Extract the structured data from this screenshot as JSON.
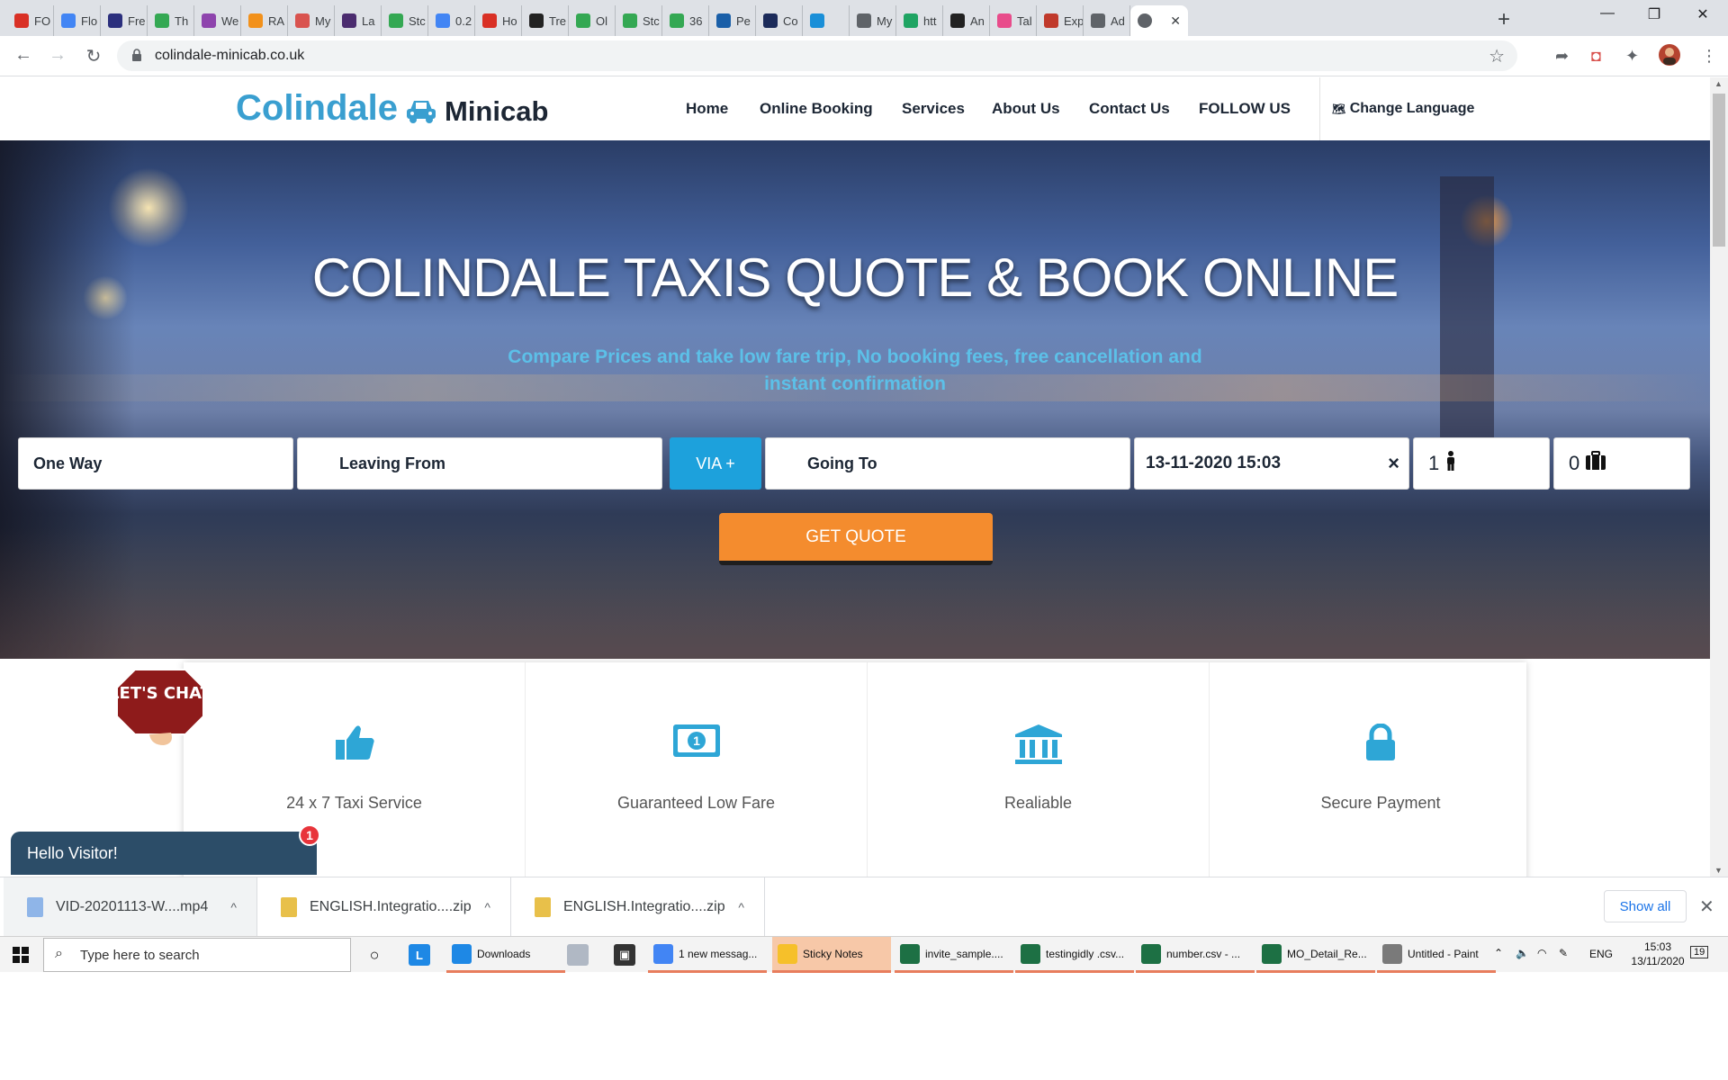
{
  "browser": {
    "tabs": [
      {
        "label": "FO",
        "icon": "gmail-icon",
        "color": "#d93025"
      },
      {
        "label": "Flo",
        "icon": "google-icon",
        "color": "#4285f4"
      },
      {
        "label": "Fre",
        "icon": "nb-icon",
        "color": "#2b2f7d"
      },
      {
        "label": "Th",
        "icon": "maps-icon",
        "color": "#34a853"
      },
      {
        "label": "We",
        "icon": "colorful-icon",
        "color": "#8e44ad"
      },
      {
        "label": "RA",
        "icon": "rss-icon",
        "color": "#f2911b"
      },
      {
        "label": "My",
        "icon": "arrow-icon",
        "color": "#d9534f"
      },
      {
        "label": "La",
        "icon": "taxi-icon",
        "color": "#4b2c6f"
      },
      {
        "label": "Stc",
        "icon": "maps-icon",
        "color": "#34a853"
      },
      {
        "label": "0.2",
        "icon": "google-icon",
        "color": "#4285f4"
      },
      {
        "label": "Ho",
        "icon": "n-icon",
        "color": "#d93025"
      },
      {
        "label": "Tre",
        "icon": "taxi-icon",
        "color": "#222"
      },
      {
        "label": "Ol",
        "icon": "maps-icon",
        "color": "#34a853"
      },
      {
        "label": "Stc",
        "icon": "maps-icon",
        "color": "#34a853"
      },
      {
        "label": "36",
        "icon": "maps-icon",
        "color": "#34a853"
      },
      {
        "label": "Pe",
        "icon": "c-icon",
        "color": "#1a5fa8"
      },
      {
        "label": "Co",
        "icon": "utv-icon",
        "color": "#1c2b5a"
      },
      {
        "label": "",
        "icon": "y-icon",
        "color": "#1a8fd8"
      },
      {
        "label": "My",
        "icon": "globe-icon",
        "color": "#5f6368"
      },
      {
        "label": "htt",
        "icon": "star-icon",
        "color": "#1fa463"
      },
      {
        "label": "An",
        "icon": "taxi-icon",
        "color": "#222"
      },
      {
        "label": "Tal",
        "icon": "stack-icon",
        "color": "#e84c8b"
      },
      {
        "label": "Exp",
        "icon": "ex-icon",
        "color": "#c0392b"
      },
      {
        "label": "Ad",
        "icon": "globe-icon",
        "color": "#5f6368"
      }
    ],
    "active_tab_close": "✕",
    "new_tab": "+",
    "url": "colindale-minicab.co.uk"
  },
  "site": {
    "logo_part1": "Colindale",
    "logo_part2": "Minicab",
    "nav": [
      "Home",
      "Online Booking",
      "Services",
      "About Us",
      "Contact Us",
      "FOLLOW US"
    ],
    "change_language": "Change Language",
    "hero_title": "COLINDALE TAXIS QUOTE & BOOK ONLINE",
    "hero_subtitle": "Compare Prices and take low fare trip, No booking fees, free cancellation and instant confirmation",
    "form": {
      "trip_type": "One Way",
      "leaving_from": "Leaving From",
      "via": "VIA +",
      "going_to": "Going To",
      "datetime": "13-11-2020 15:03",
      "clear": "×",
      "passengers": "1",
      "luggage": "0",
      "get_quote": "GET QUOTE"
    },
    "features": [
      {
        "label": "24 x 7 Taxi Service",
        "icon": "thumbs-up-icon"
      },
      {
        "label": "Guaranteed Low Fare",
        "icon": "money-icon"
      },
      {
        "label": "Realiable",
        "icon": "bank-icon"
      },
      {
        "label": "Secure Payment",
        "icon": "lock-icon"
      }
    ],
    "chat": {
      "bubble": "LET'S CHAT",
      "greeting": "Hello Visitor!",
      "badge": "1"
    }
  },
  "downloads": {
    "items": [
      {
        "name": "VID-20201113-W....mp4"
      },
      {
        "name": "ENGLISH.Integratio....zip"
      },
      {
        "name": "ENGLISH.Integratio....zip"
      }
    ],
    "show_all": "Show all"
  },
  "taskbar": {
    "search_placeholder": "Type here to search",
    "apps": [
      {
        "label": "Downloads",
        "color": "#1e88e5"
      },
      {
        "label": "1 new messag...",
        "color": "#4285f4"
      },
      {
        "label": "Sticky Notes",
        "color": "#f6c02a"
      },
      {
        "label": "invite_sample....",
        "color": "#1d7044"
      },
      {
        "label": "testingidly .csv...",
        "color": "#1d7044"
      },
      {
        "label": "number.csv - ...",
        "color": "#1d7044"
      },
      {
        "label": "MO_Detail_Re...",
        "color": "#1d7044"
      },
      {
        "label": "Untitled - Paint",
        "color": "#7a7a7a"
      }
    ],
    "lang": "ENG",
    "time": "15:03",
    "date": "13/11/2020",
    "notif": "19"
  },
  "colors": {
    "brand_blue": "#3a9fd0",
    "accent_orange": "#f48c2e",
    "via_blue": "#1da1dc",
    "chat_dark": "#2c4d68"
  }
}
